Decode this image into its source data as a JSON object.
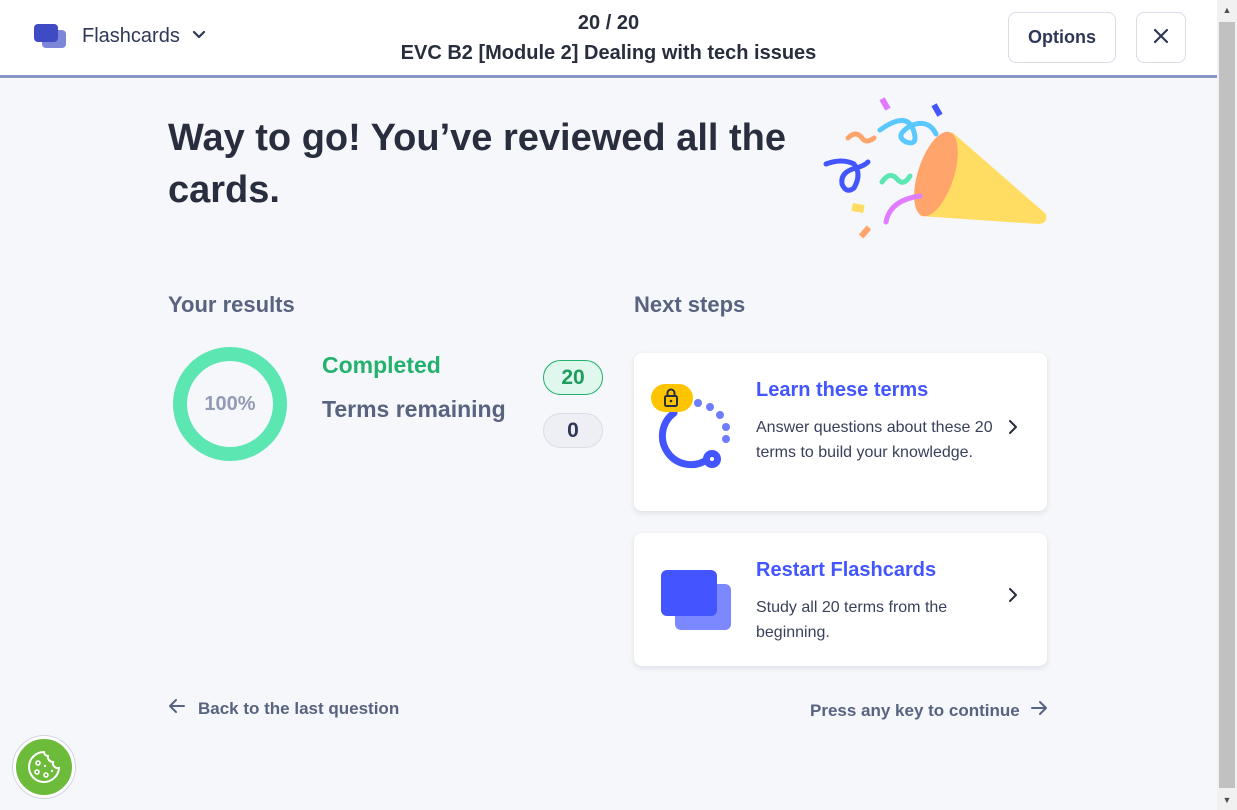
{
  "header": {
    "mode_label": "Flashcards",
    "progress": "20 / 20",
    "set_title": "EVC B2 [Module 2] Dealing with tech issues",
    "options_label": "Options",
    "icons": {
      "mode": "flashcards-icon",
      "dropdown": "chevron-down-icon",
      "close": "close-icon"
    }
  },
  "hero": {
    "headline": "Way to go! You’ve reviewed all the cards."
  },
  "results": {
    "title": "Your results",
    "percent_text": "100%",
    "percent_value": 1.0,
    "completed_label": "Completed",
    "completed_count": "20",
    "remaining_label": "Terms remaining",
    "remaining_count": "0"
  },
  "next_steps": {
    "title": "Next steps",
    "cards": [
      {
        "title": "Learn these terms",
        "description": "Answer questions about these 20 terms to build your knowledge.",
        "icon": "learn-locked-icon"
      },
      {
        "title": "Restart Flashcards",
        "description": "Study all 20 terms from the beginning.",
        "icon": "flashcards-icon"
      }
    ]
  },
  "footer": {
    "back_label": "Back to the last question",
    "continue_label": "Press any key to continue"
  },
  "colors": {
    "accent": "#4255ff",
    "success": "#23b26d",
    "ring": "#5ce6b2",
    "cookie": "#6dbb3b"
  }
}
